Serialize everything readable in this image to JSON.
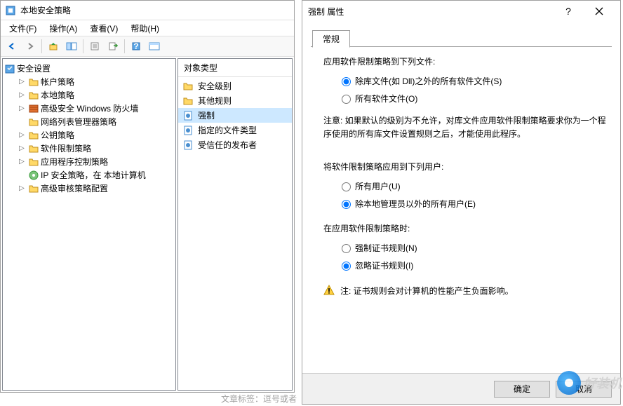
{
  "mainWindow": {
    "title": "本地安全策略",
    "menu": {
      "file": "文件(F)",
      "action": "操作(A)",
      "view": "查看(V)",
      "help": "帮助(H)"
    },
    "tree": {
      "root": "安全设置",
      "items": [
        "帐户策略",
        "本地策略",
        "高级安全 Windows 防火墙",
        "网络列表管理器策略",
        "公钥策略",
        "软件限制策略",
        "应用程序控制策略",
        "IP 安全策略，在 本地计算机",
        "高级审核策略配置"
      ]
    },
    "listHeader": "对象类型",
    "listItems": [
      {
        "label": "安全级别",
        "icon": "folder"
      },
      {
        "label": "其他规则",
        "icon": "folder"
      },
      {
        "label": "强制",
        "icon": "policy",
        "selected": true
      },
      {
        "label": "指定的文件类型",
        "icon": "policy"
      },
      {
        "label": "受信任的发布者",
        "icon": "policy"
      }
    ]
  },
  "dialog": {
    "title": "强制 属性",
    "tab": "常规",
    "s1": {
      "label": "应用软件限制策略到下列文件:",
      "opt1": "除库文件(如 Dll)之外的所有软件文件(S)",
      "opt2": "所有软件文件(O)"
    },
    "note1": "注意: 如果默认的级别为不允许，对库文件应用软件限制策略要求你为一个程序使用的所有库文件设置规则之后，才能使用此程序。",
    "s2": {
      "label": "将软件限制策略应用到下列用户:",
      "opt1": "所有用户(U)",
      "opt2": "除本地管理员以外的所有用户(E)"
    },
    "s3": {
      "label": "在应用软件限制策略时:",
      "opt1": "强制证书规则(N)",
      "opt2": "忽略证书规则(I)"
    },
    "warn": "注: 证书规则会对计算机的性能产生负面影响。",
    "buttons": {
      "ok": "确定",
      "cancel": "取消"
    }
  },
  "footer": "文章标签：逗号或者",
  "watermark": "好装机"
}
